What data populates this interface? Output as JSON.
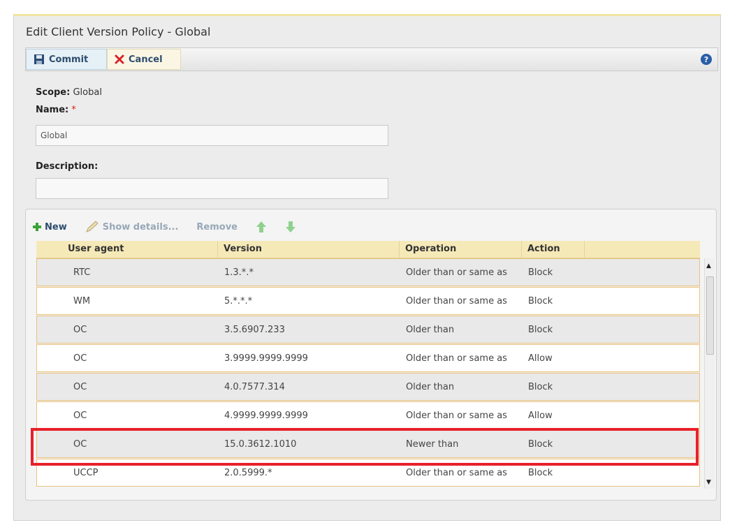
{
  "dialog": {
    "title": "Edit Client Version Policy - Global"
  },
  "toolbar": {
    "commit_label": "Commit",
    "cancel_label": "Cancel",
    "help_icon": "?"
  },
  "form": {
    "scope_label": "Scope:",
    "scope_value": "Global",
    "name_label": "Name:",
    "name_required": "*",
    "name_value": "Global",
    "description_label": "Description:",
    "description_value": ""
  },
  "grid_toolbar": {
    "new_label": "New",
    "show_details_label": "Show details...",
    "remove_label": "Remove"
  },
  "table": {
    "columns": [
      "User agent",
      "Version",
      "Operation",
      "Action"
    ],
    "rows": [
      {
        "user_agent": "RTC",
        "version": "1.3.*.*",
        "operation": "Older than or same as",
        "action": "Block"
      },
      {
        "user_agent": "WM",
        "version": "5.*.*.*",
        "operation": "Older than or same as",
        "action": "Block"
      },
      {
        "user_agent": "OC",
        "version": "3.5.6907.233",
        "operation": "Older than",
        "action": "Block"
      },
      {
        "user_agent": "OC",
        "version": "3.9999.9999.9999",
        "operation": "Older than or same as",
        "action": "Allow"
      },
      {
        "user_agent": "OC",
        "version": "4.0.7577.314",
        "operation": "Older than",
        "action": "Block"
      },
      {
        "user_agent": "OC",
        "version": "4.9999.9999.9999",
        "operation": "Older than or same as",
        "action": "Allow"
      },
      {
        "user_agent": "OC",
        "version": "15.0.3612.1010",
        "operation": "Newer than",
        "action": "Block"
      },
      {
        "user_agent": "UCCP",
        "version": "2.0.5999.*",
        "operation": "Older than or same as",
        "action": "Block"
      }
    ]
  },
  "colors": {
    "highlight": "#e8202a",
    "header_bg": "#f6e9b8",
    "row_border": "#e8c27e"
  }
}
